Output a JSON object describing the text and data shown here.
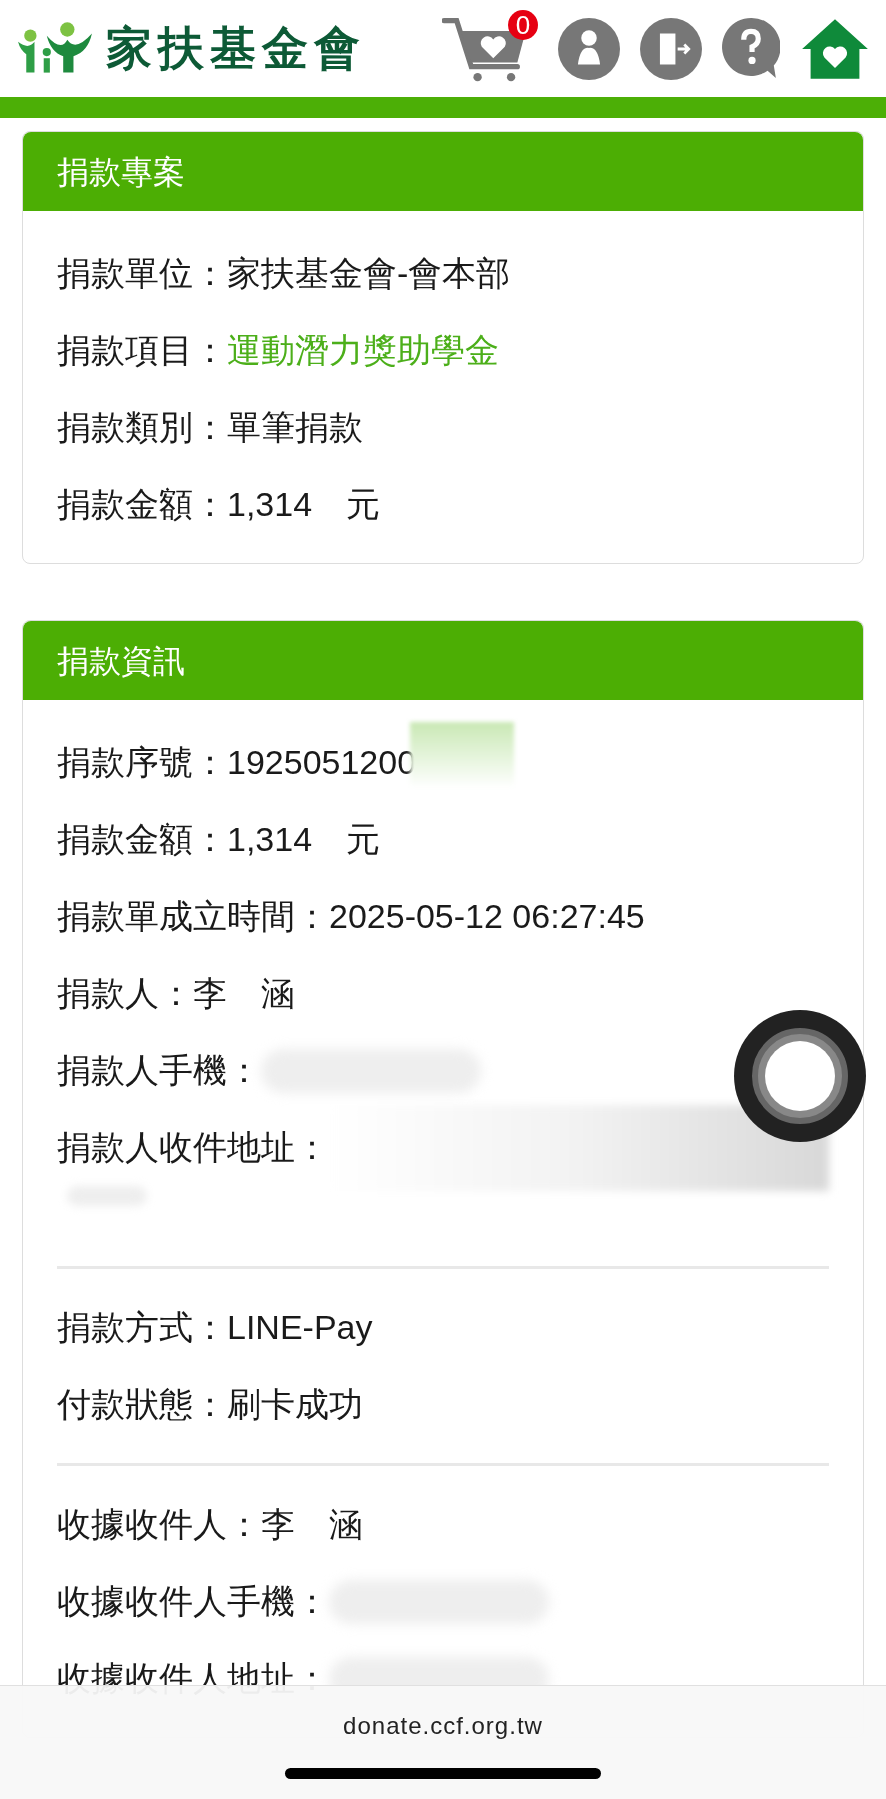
{
  "header": {
    "logo_text": "家扶基金會",
    "cart_count": "0"
  },
  "cards": [
    {
      "title": "捐款專案",
      "groups": [
        [
          {
            "label": "捐款單位：",
            "value": "家扶基金會-會本部",
            "kind": "text"
          },
          {
            "label": "捐款項目：",
            "value": "運動潛力獎助學金",
            "kind": "highlight"
          },
          {
            "label": "捐款類別：",
            "value": "單筆捐款",
            "kind": "text"
          },
          {
            "label": "捐款金額：",
            "value": "1,314　元",
            "kind": "text"
          }
        ]
      ]
    },
    {
      "title": "捐款資訊",
      "groups": [
        [
          {
            "label": "捐款序號：",
            "value": "1925051200",
            "kind": "partly_masked"
          },
          {
            "label": "捐款金額：",
            "value": "1,314　元",
            "kind": "text"
          },
          {
            "label": "捐款單成立時間：",
            "value": "2025-05-12 06:27:45",
            "kind": "text"
          },
          {
            "label": "捐款人：",
            "value": "李　涵",
            "kind": "text"
          },
          {
            "label": "捐款人手機：",
            "kind": "masked"
          },
          {
            "label": "捐款人收件地址：",
            "kind": "masked_long"
          }
        ],
        [
          {
            "label": "捐款方式：",
            "value": "LINE-Pay",
            "kind": "text"
          },
          {
            "label": "付款狀態：",
            "value": "刷卡成功",
            "kind": "text"
          }
        ],
        [
          {
            "label": "收據收件人：",
            "value": "李　涵",
            "kind": "text"
          },
          {
            "label": "收據收件人手機：",
            "kind": "masked"
          },
          {
            "label": "收據收件人地址：",
            "kind": "masked"
          }
        ]
      ]
    }
  ],
  "browser_bar": {
    "url": "donate.ccf.org.tw"
  }
}
